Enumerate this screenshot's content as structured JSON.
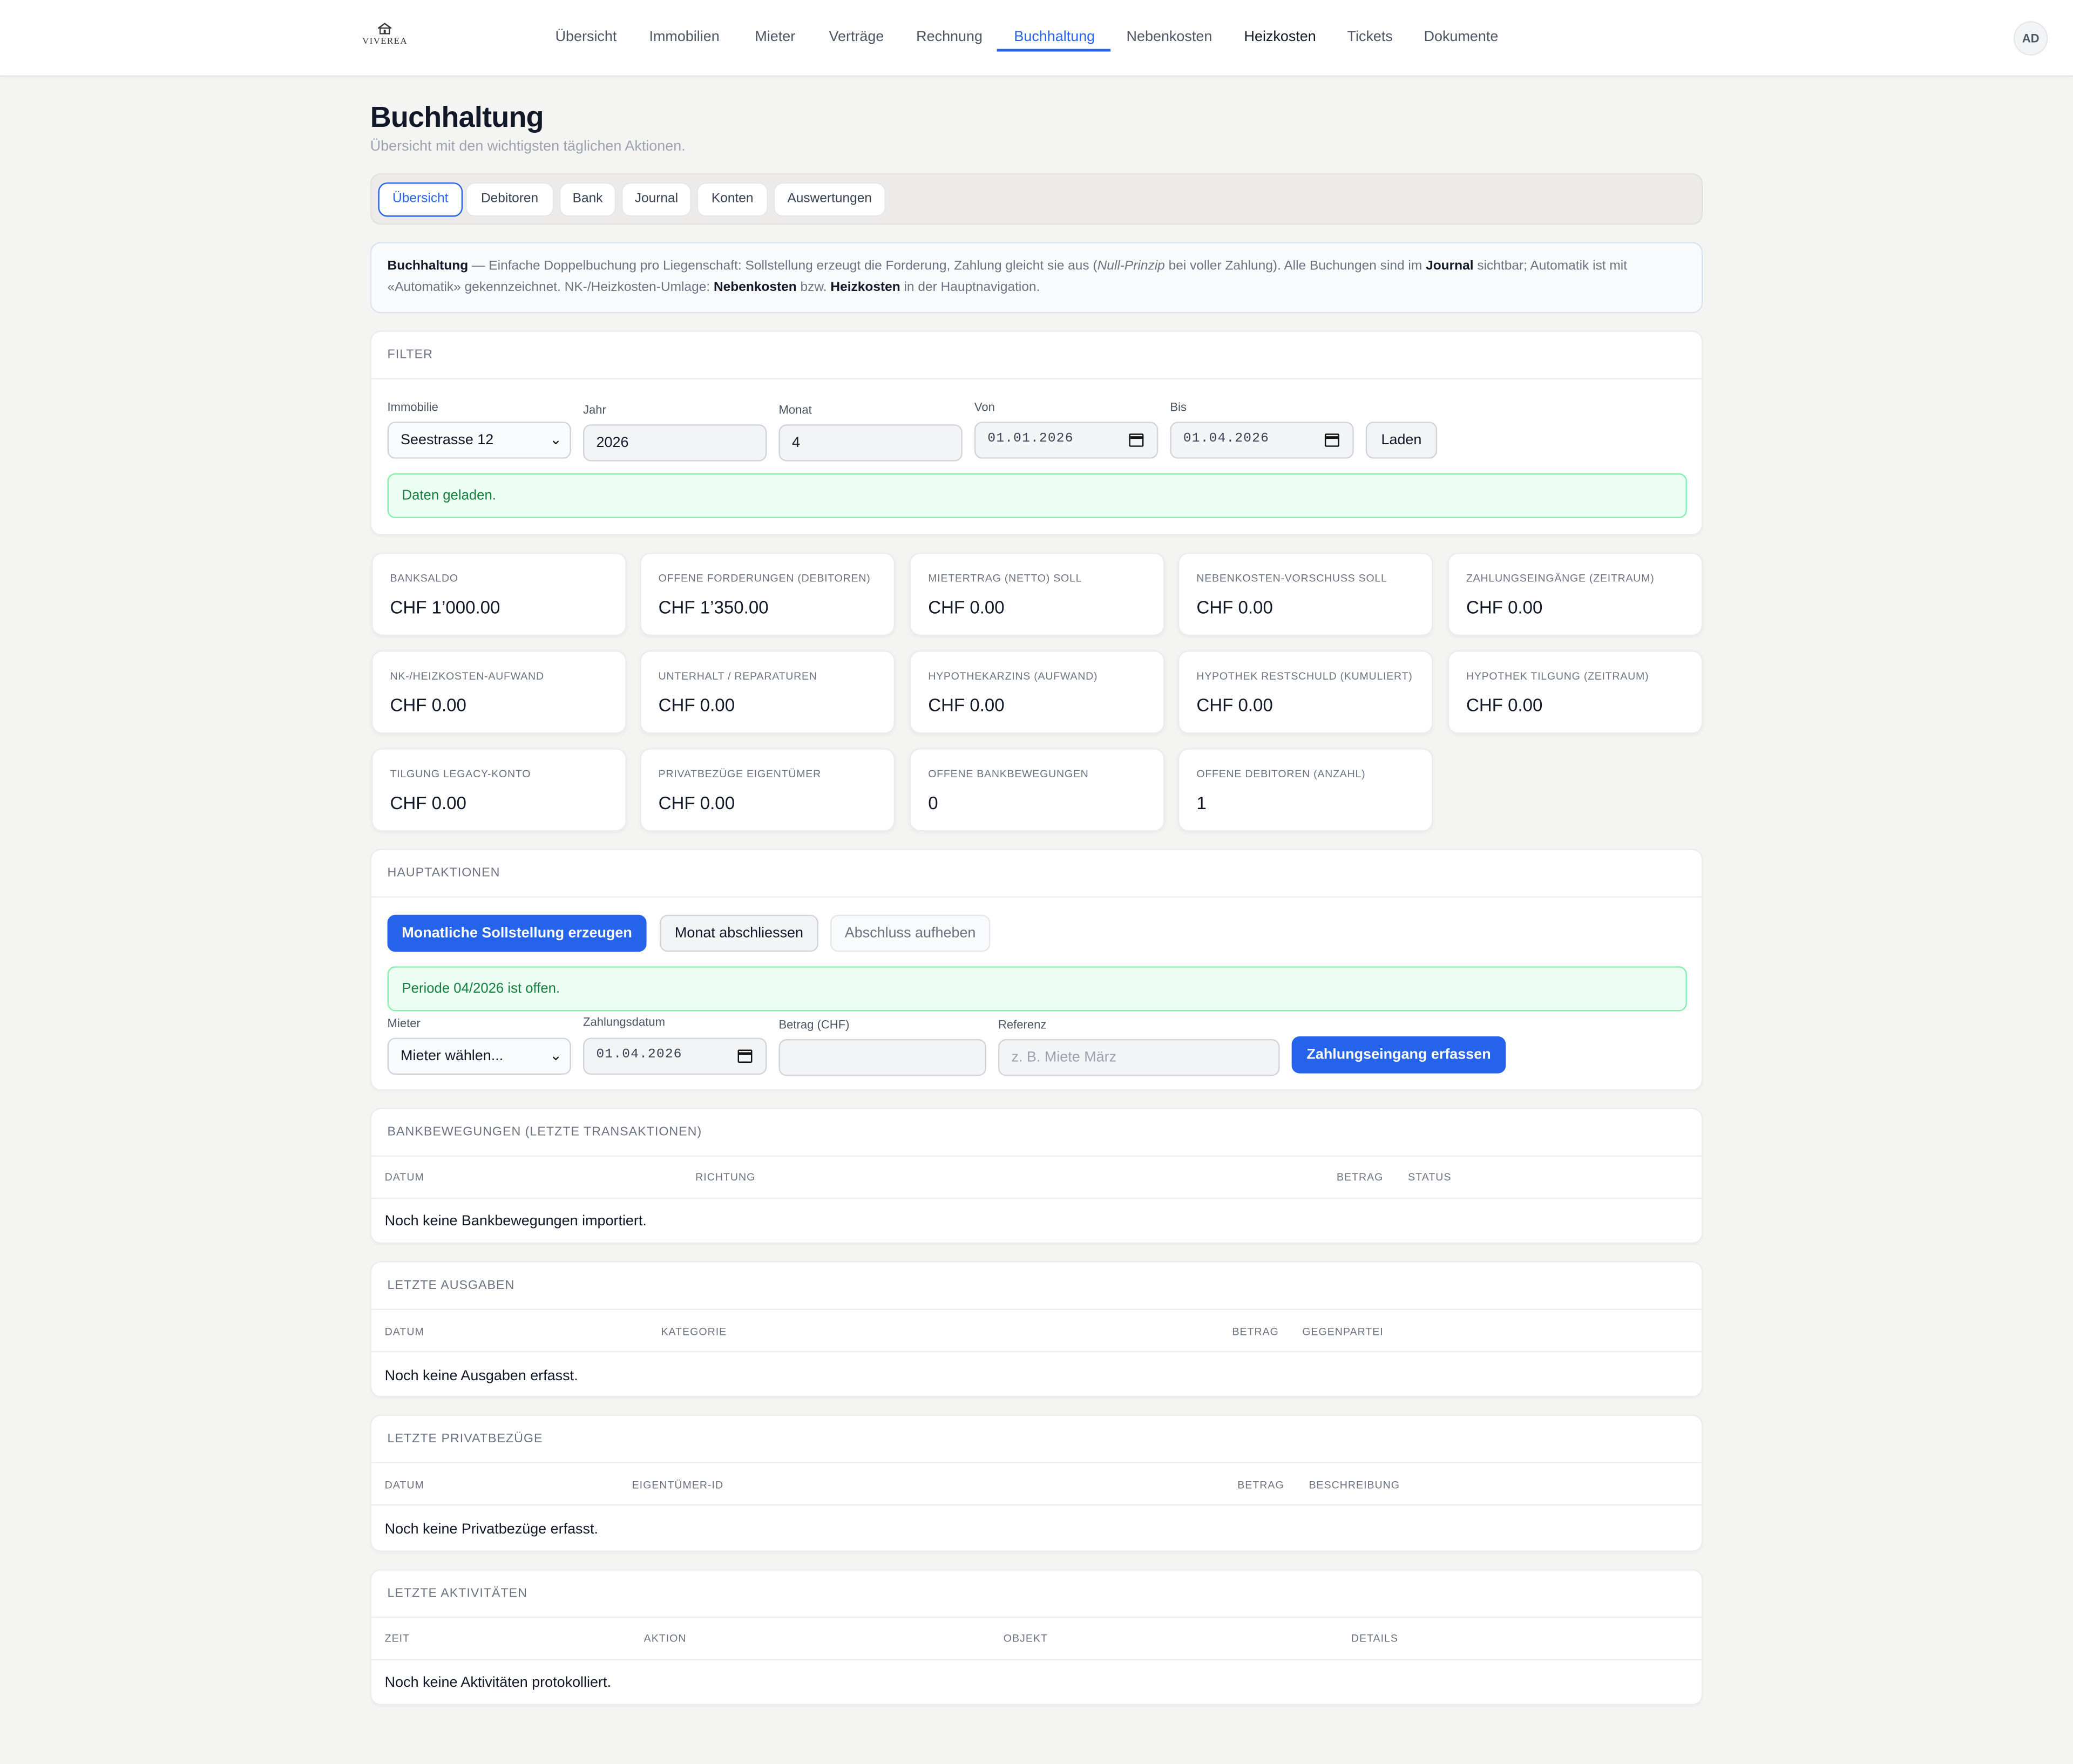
{
  "brand": {
    "logo_text": "VIVEREA"
  },
  "nav": {
    "items": [
      {
        "label": "Übersicht"
      },
      {
        "label": "Immobilien"
      },
      {
        "label": "Mieter"
      },
      {
        "label": "Verträge"
      },
      {
        "label": "Rechnung"
      },
      {
        "label": "Buchhaltung",
        "active": true
      },
      {
        "label": "Nebenkosten"
      },
      {
        "label": "Heizkosten"
      },
      {
        "label": "Tickets"
      },
      {
        "label": "Dokumente"
      }
    ],
    "avatar": "AD"
  },
  "page": {
    "title": "Buchhaltung",
    "subtitle": "Übersicht mit den wichtigsten täglichen Aktionen."
  },
  "tabs": [
    "Übersicht",
    "Debitoren",
    "Bank",
    "Journal",
    "Konten",
    "Auswertungen"
  ],
  "info": {
    "title": "Buchhaltung",
    "text1": " — Einfache Doppelbuchung pro Liegenschaft: Sollstellung erzeugt die Forderung, Zahlung gleicht sie aus (",
    "italic": "Null-Prinzip",
    "text2": " bei voller Zahlung). Alle Buchungen sind im ",
    "journal": "Journal",
    "text3": " sichtbar; Automatik ist mit «Automatik» gekennzeichnet. NK-/Heizkosten-Umlage: ",
    "nebenkosten": "Nebenkosten",
    "text4": " bzw. ",
    "heizkosten": "Heizkosten",
    "text5": " in der Hauptnavigation."
  },
  "filter": {
    "title": "Filter",
    "immobilie_label": "Immobilie",
    "immobilie_value": "Seestrasse 12",
    "jahr_label": "Jahr",
    "jahr_value": "2026",
    "monat_label": "Monat",
    "monat_value": "4",
    "von_label": "Von",
    "von_value": "01.01.2026",
    "bis_label": "Bis",
    "bis_value": "01.04.2026",
    "load_button": "Laden",
    "status": "Daten geladen."
  },
  "kpis": [
    {
      "label": "Banksaldo",
      "value": "CHF 1’000.00"
    },
    {
      "label": "Offene Forderungen (Debitoren)",
      "value": "CHF 1’350.00"
    },
    {
      "label": "Mietertrag (netto) Soll",
      "value": "CHF 0.00"
    },
    {
      "label": "Nebenkosten-Vorschuss Soll",
      "value": "CHF 0.00"
    },
    {
      "label": "Zahlungseingänge (Zeitraum)",
      "value": "CHF 0.00"
    },
    {
      "label": "NK-/Heizkosten-Aufwand",
      "value": "CHF 0.00"
    },
    {
      "label": "Unterhalt / Reparaturen",
      "value": "CHF 0.00"
    },
    {
      "label": "Hypothekarzins (Aufwand)",
      "value": "CHF 0.00"
    },
    {
      "label": "Hypothek Restschuld (kumuliert)",
      "value": "CHF 0.00"
    },
    {
      "label": "Hypothek Tilgung (Zeitraum)",
      "value": "CHF 0.00"
    },
    {
      "label": "Tilgung Legacy-Konto",
      "value": "CHF 0.00"
    },
    {
      "label": "Privatbezüge Eigentümer",
      "value": "CHF 0.00"
    },
    {
      "label": "Offene Bankbewegungen",
      "value": "0"
    },
    {
      "label": "Offene Debitoren (Anzahl)",
      "value": "1"
    }
  ],
  "actions": {
    "title": "Hauptaktionen",
    "btn_sollstellung": "Monatliche Sollstellung erzeugen",
    "btn_abschliessen": "Monat abschliessen",
    "btn_aufheben": "Abschluss aufheben",
    "status": "Periode 04/2026 ist offen.",
    "mieter_label": "Mieter",
    "mieter_value": "Mieter wählen...",
    "datum_label": "Zahlungsdatum",
    "datum_value": "01.04.2026",
    "betrag_label": "Betrag (CHF)",
    "betrag_value": "",
    "referenz_label": "Referenz",
    "referenz_placeholder": "z. B. Miete März",
    "btn_zahlung": "Zahlungseingang erfassen"
  },
  "bank": {
    "title": "Bankbewegungen (letzte Transaktionen)",
    "columns": [
      "Datum",
      "Richtung",
      "Betrag",
      "Status"
    ],
    "empty": "Noch keine Bankbewegungen importiert."
  },
  "ausgaben": {
    "title": "Letzte Ausgaben",
    "columns": [
      "Datum",
      "Kategorie",
      "Betrag",
      "Gegenpartei"
    ],
    "empty": "Noch keine Ausgaben erfasst."
  },
  "privat": {
    "title": "Letzte Privatbezüge",
    "columns": [
      "Datum",
      "Eigentümer-ID",
      "Betrag",
      "Beschreibung"
    ],
    "empty": "Noch keine Privatbezüge erfasst."
  },
  "aktiv": {
    "title": "Letzte Aktivitäten",
    "columns": [
      "Zeit",
      "Aktion",
      "Objekt",
      "Details"
    ],
    "empty": "Noch keine Aktivitäten protokolliert."
  },
  "colors": {
    "accent": "#2563eb",
    "success_bg": "#ecfdf3",
    "success_text": "#15803d",
    "background": "#f4f4f3"
  }
}
